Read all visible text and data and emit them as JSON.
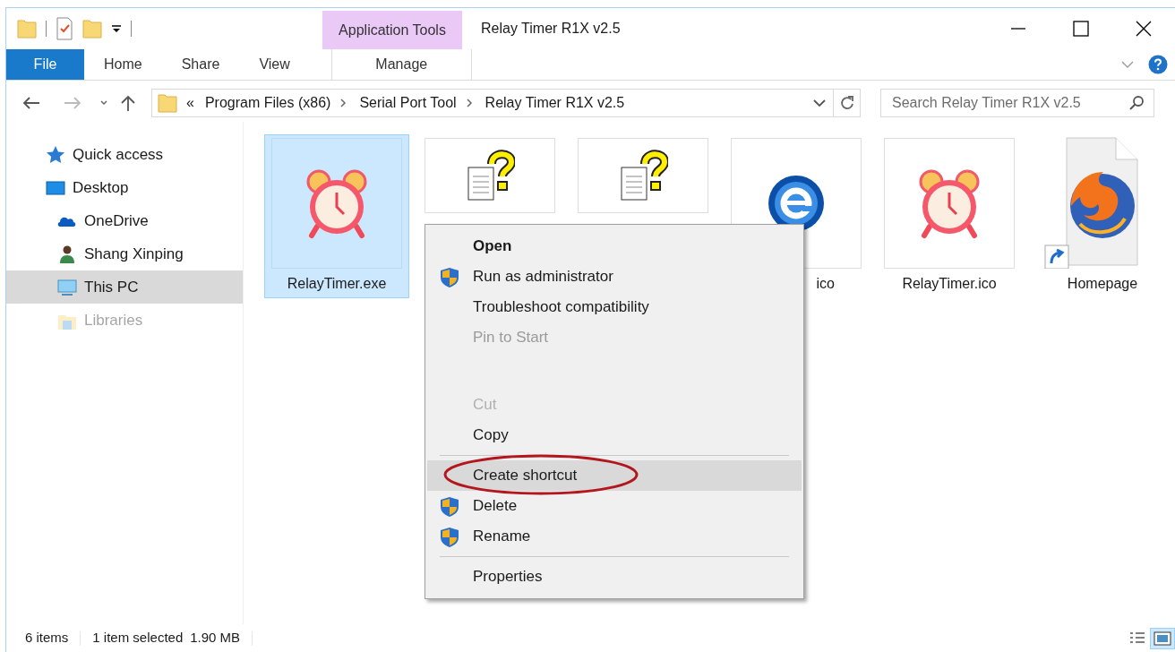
{
  "window": {
    "title": "Relay Timer R1X v2.5",
    "context_tab_group": "Application Tools"
  },
  "ribbon_tabs": [
    {
      "label": "File",
      "selected": true,
      "kind": "file"
    },
    {
      "label": "Home",
      "selected": false,
      "kind": "tab"
    },
    {
      "label": "Share",
      "selected": false,
      "kind": "tab"
    },
    {
      "label": "View",
      "selected": false,
      "kind": "tab"
    },
    {
      "label": "Manage",
      "selected": false,
      "kind": "context"
    }
  ],
  "address_bar": {
    "overflow": "«",
    "crumbs": [
      "Program Files (x86)",
      "Serial Port Tool",
      "Relay Timer R1X v2.5"
    ]
  },
  "search": {
    "placeholder": "Search Relay Timer R1X v2.5"
  },
  "sidebar": {
    "items": [
      {
        "label": "Quick access",
        "kind": "star",
        "selected": false,
        "dimmed": false
      },
      {
        "label": "Desktop",
        "kind": "desktop",
        "selected": false,
        "dimmed": false,
        "children": [
          {
            "label": "OneDrive",
            "kind": "cloud",
            "selected": false,
            "dimmed": false
          },
          {
            "label": "Shang Xinping",
            "kind": "person",
            "selected": false,
            "dimmed": false
          },
          {
            "label": "This PC",
            "kind": "pc",
            "selected": true,
            "dimmed": false
          },
          {
            "label": "Libraries",
            "kind": "library",
            "selected": false,
            "dimmed": true
          }
        ]
      }
    ]
  },
  "files": [
    {
      "name": "RelayTimer.exe",
      "kind": "alarm",
      "selected": true
    },
    {
      "kind": "unknown",
      "selected": false
    },
    {
      "kind": "unknown",
      "selected": false
    },
    {
      "name": "ico",
      "kind": "ie",
      "selected": false
    },
    {
      "name": "RelayTimer.ico",
      "kind": "alarm",
      "selected": false
    },
    {
      "name": "Homepage",
      "kind": "firefox-shortcut",
      "selected": false
    }
  ],
  "context_menu": [
    {
      "kind": "item",
      "label": "Open",
      "bold": true,
      "shield": false,
      "disabled": false,
      "dimmed": false,
      "selected": false
    },
    {
      "kind": "item",
      "label": "Run as administrator",
      "bold": false,
      "shield": true,
      "disabled": false,
      "dimmed": false,
      "selected": false
    },
    {
      "kind": "item",
      "label": "Troubleshoot compatibility",
      "bold": false,
      "shield": false,
      "disabled": false,
      "dimmed": false,
      "selected": false
    },
    {
      "kind": "item",
      "label": "Pin to Start",
      "bold": false,
      "shield": false,
      "disabled": false,
      "dimmed": true,
      "selected": false
    },
    {
      "kind": "gap"
    },
    {
      "kind": "item",
      "label": "Cut",
      "bold": false,
      "shield": false,
      "disabled": true,
      "dimmed": false,
      "selected": false
    },
    {
      "kind": "item",
      "label": "Copy",
      "bold": false,
      "shield": false,
      "disabled": false,
      "dimmed": false,
      "selected": false
    },
    {
      "kind": "separator"
    },
    {
      "kind": "item",
      "label": "Create shortcut",
      "bold": false,
      "shield": false,
      "disabled": false,
      "dimmed": false,
      "selected": true
    },
    {
      "kind": "item",
      "label": "Delete",
      "bold": false,
      "shield": true,
      "disabled": false,
      "dimmed": false,
      "selected": false
    },
    {
      "kind": "item",
      "label": "Rename",
      "bold": false,
      "shield": true,
      "disabled": false,
      "dimmed": false,
      "selected": false
    },
    {
      "kind": "separator"
    },
    {
      "kind": "item",
      "label": "Properties",
      "bold": false,
      "shield": false,
      "disabled": false,
      "dimmed": false,
      "selected": false
    }
  ],
  "status_bar": {
    "item_count": "6 items",
    "selection": "1 item selected",
    "size": "1.90 MB",
    "views": [
      {
        "kind": "details",
        "selected": false
      },
      {
        "kind": "large-icons",
        "selected": true
      }
    ]
  }
}
